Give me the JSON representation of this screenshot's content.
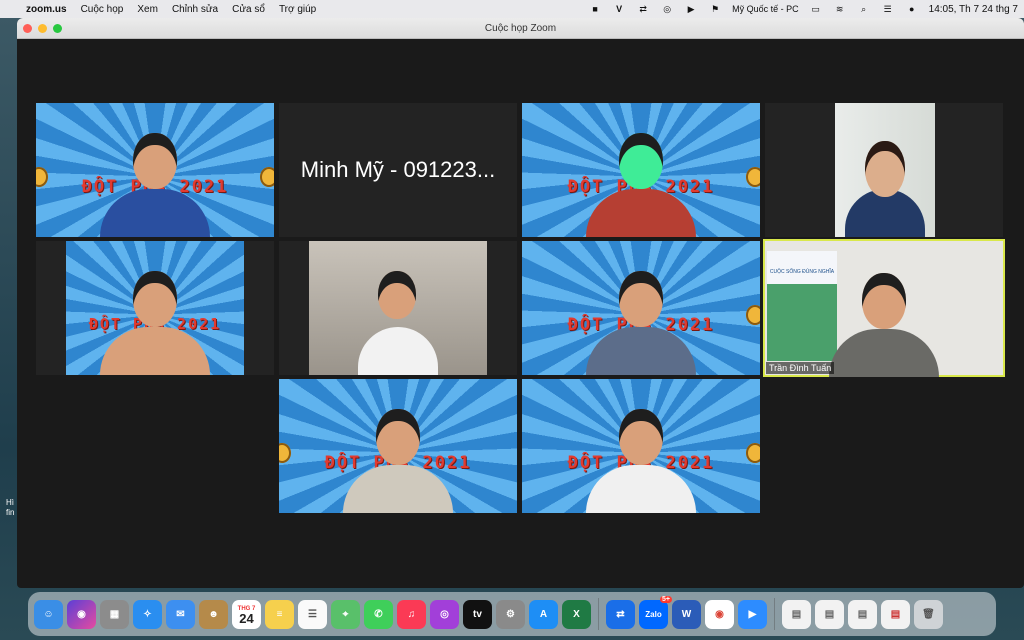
{
  "menubar": {
    "app": "zoom.us",
    "items": [
      "Cuộc họp",
      "Xem",
      "Chỉnh sửa",
      "Cửa sổ",
      "Trợ giúp"
    ],
    "input_source": "Mỹ Quốc tế - PC",
    "clock": "14:05, Th 7 24 thg 7"
  },
  "window": {
    "title": "Cuộc họp Zoom"
  },
  "tiles": {
    "banner": "ĐỘT PHÁ 2021",
    "minh_my": "Minh Mỹ - 091223...",
    "tran_dinh_tuan": "Trần Đình Tuấn",
    "poster": "CUỘC SỐNG ĐÚNG NGHĨA"
  },
  "desktop": {
    "text1": "Hì",
    "text2": "fin"
  },
  "dock": {
    "calendar_month": "THG 7",
    "calendar_day": "24",
    "zalo_badge": "5+",
    "tv_label": "tv",
    "zalo_label": "Zalo",
    "word_label": "W",
    "excel_label": "X",
    "appstore_label": "A"
  },
  "colors": {
    "active_border": "#d9e84a",
    "banner_red": "#e23a2f",
    "bg_blue": "#2f86cf"
  }
}
